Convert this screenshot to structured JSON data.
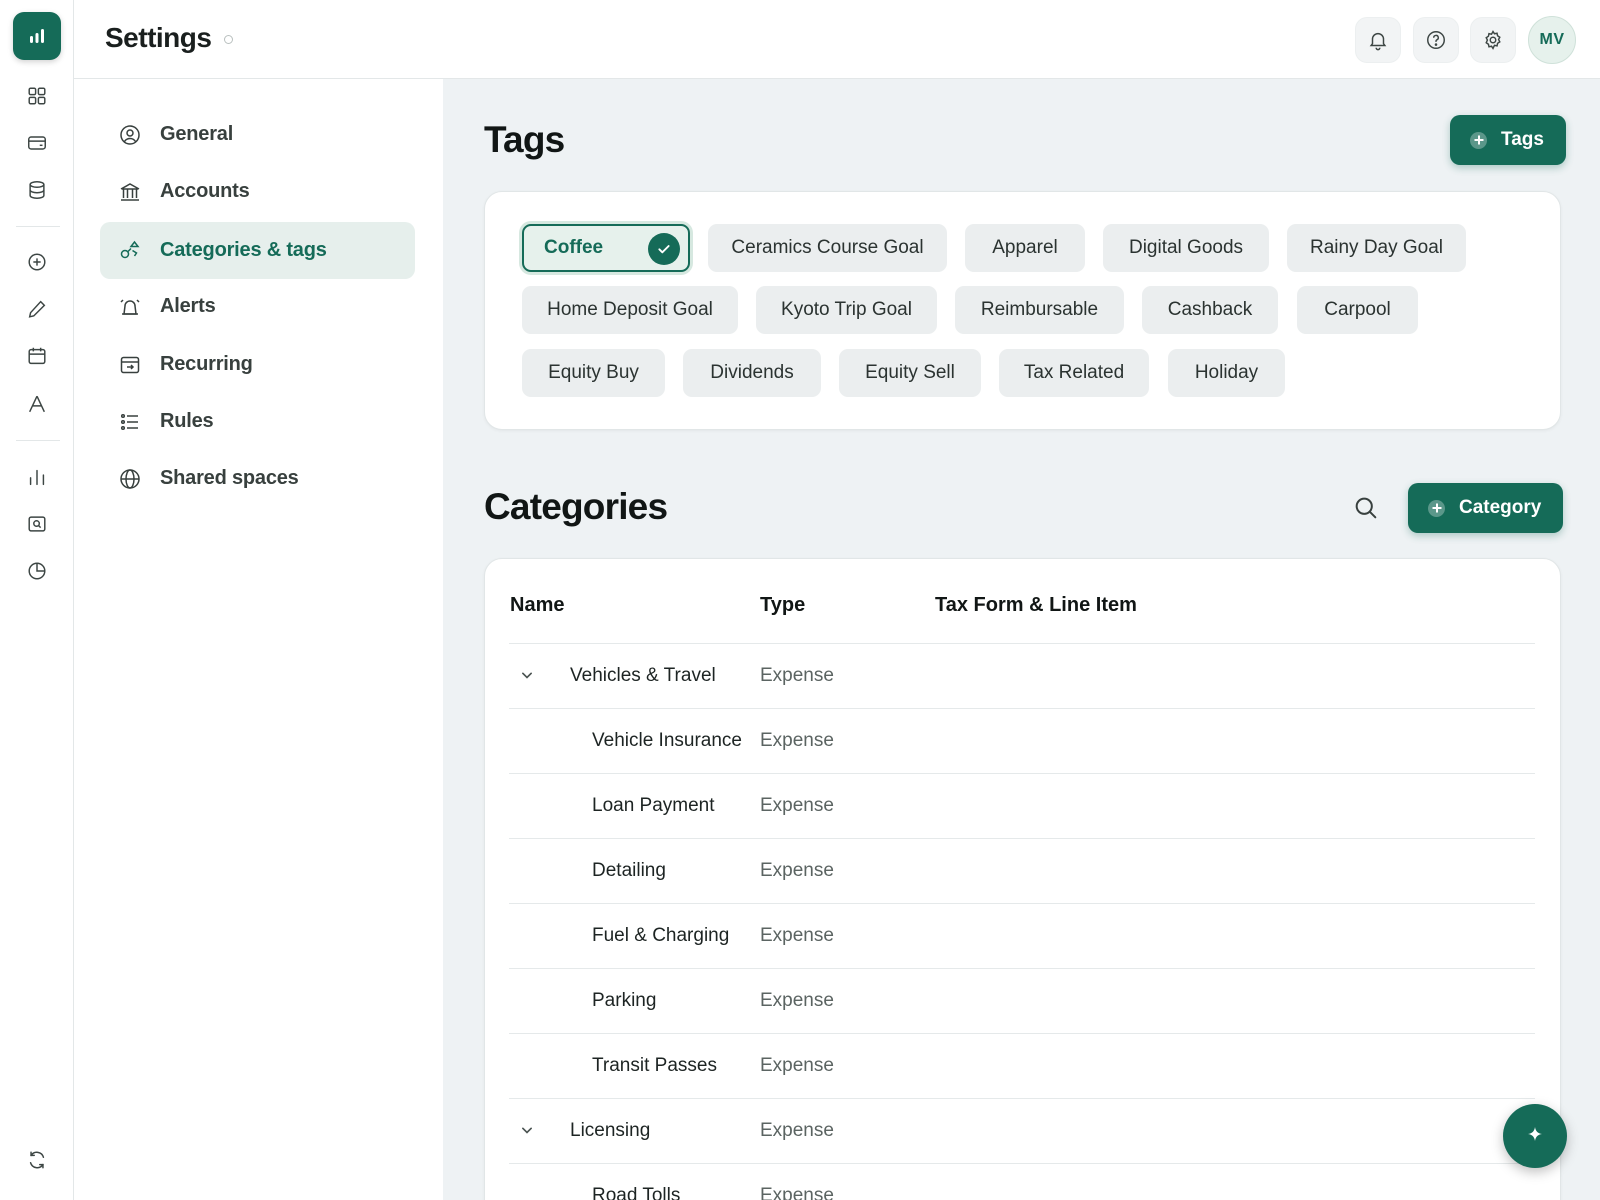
{
  "header": {
    "title": "Settings",
    "avatar_initials": "MV"
  },
  "settings_nav": [
    {
      "label": "General",
      "icon": "user-circle-icon"
    },
    {
      "label": "Accounts",
      "icon": "bank-icon"
    },
    {
      "label": "Categories & tags",
      "icon": "shapes-icon",
      "active": true
    },
    {
      "label": "Alerts",
      "icon": "alarm-icon"
    },
    {
      "label": "Recurring",
      "icon": "recurring-icon"
    },
    {
      "label": "Rules",
      "icon": "list-icon"
    },
    {
      "label": "Shared spaces",
      "icon": "globe-icon"
    }
  ],
  "tags_section": {
    "title": "Tags",
    "add_button": "Tags",
    "tags": [
      "Coffee",
      "Ceramics Course Goal",
      "Apparel",
      "Digital Goods",
      "Rainy Day Goal",
      "Home Deposit Goal",
      "Kyoto Trip Goal",
      "Reimbursable",
      "Cashback",
      "Carpool",
      "Equity Buy",
      "Dividends",
      "Equity Sell",
      "Tax Related",
      "Holiday"
    ],
    "selected_tag": "Coffee"
  },
  "categories_section": {
    "title": "Categories",
    "add_button": "Category",
    "columns": [
      "Name",
      "Type",
      "Tax Form & Line Item"
    ],
    "rows": [
      {
        "name": "Vehicles & Travel",
        "type": "Expense",
        "parent": true
      },
      {
        "name": "Vehicle Insurance",
        "type": "Expense"
      },
      {
        "name": "Loan Payment",
        "type": "Expense"
      },
      {
        "name": "Detailing",
        "type": "Expense"
      },
      {
        "name": "Fuel & Charging",
        "type": "Expense"
      },
      {
        "name": "Parking",
        "type": "Expense"
      },
      {
        "name": "Transit Passes",
        "type": "Expense"
      },
      {
        "name": "Licensing",
        "type": "Expense",
        "parent": true
      },
      {
        "name": "Road Tolls",
        "type": "Expense"
      }
    ]
  },
  "colors": {
    "brand": "#156b58",
    "page_bg": "#eef2f4",
    "active_nav_bg": "#e6efec"
  }
}
